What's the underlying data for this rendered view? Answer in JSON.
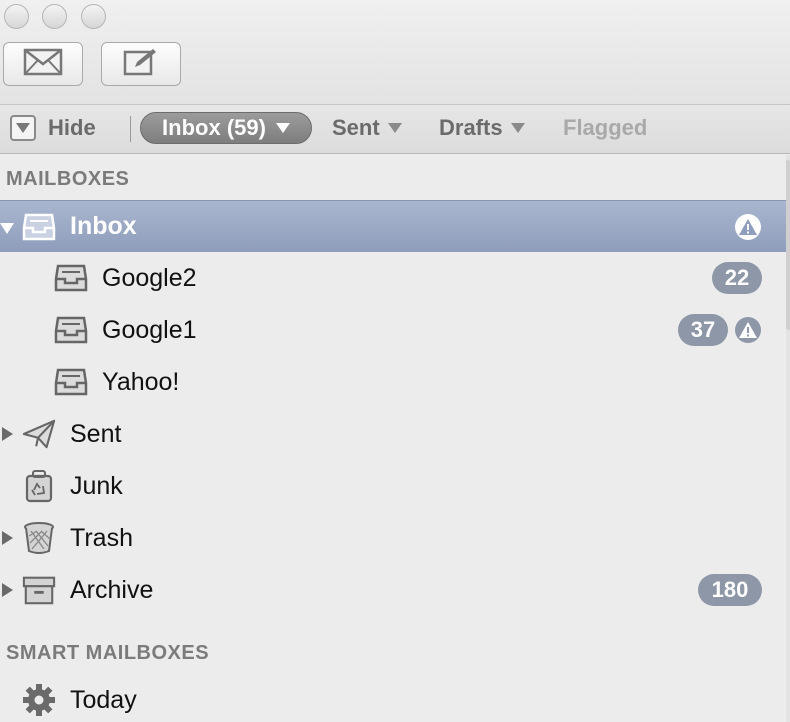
{
  "toolbar": {
    "get_mail_icon": "envelope-icon",
    "compose_icon": "compose-icon"
  },
  "favorites": {
    "hide_label": "Hide",
    "inbox_label": "Inbox (59)",
    "sent_label": "Sent",
    "drafts_label": "Drafts",
    "flagged_label": "Flagged"
  },
  "sidebar": {
    "mailboxes_header": "MAILBOXES",
    "smart_header": "SMART MAILBOXES",
    "items": [
      {
        "label": "Inbox",
        "icon": "inbox-tray-icon",
        "selected": true,
        "expanded": true,
        "alert": true
      },
      {
        "label": "Google2",
        "icon": "inbox-tray-icon",
        "badge": "22"
      },
      {
        "label": "Google1",
        "icon": "inbox-tray-icon",
        "badge": "37",
        "alert": true
      },
      {
        "label": "Yahoo!",
        "icon": "inbox-tray-icon"
      },
      {
        "label": "Sent",
        "icon": "paper-plane-icon",
        "collapsed": true
      },
      {
        "label": "Junk",
        "icon": "junk-bin-icon"
      },
      {
        "label": "Trash",
        "icon": "trash-can-icon",
        "collapsed": true
      },
      {
        "label": "Archive",
        "icon": "archive-box-icon",
        "collapsed": true,
        "badge": "180"
      }
    ],
    "smart_items": [
      {
        "label": "Today",
        "icon": "gear-icon"
      }
    ]
  },
  "colors": {
    "selection": "#9aa8c5",
    "badge": "#8e97a8"
  }
}
